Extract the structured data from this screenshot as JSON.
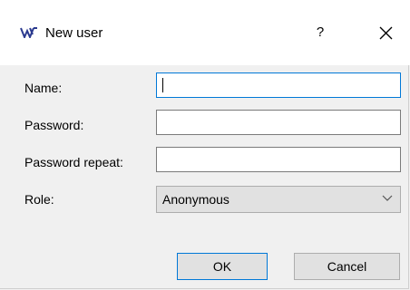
{
  "window": {
    "title": "New user",
    "help_label": "?",
    "icons": {
      "app": "app-logo-icon",
      "close": "close-icon",
      "dropdown": "chevron-down-icon"
    }
  },
  "form": {
    "name": {
      "label": "Name:",
      "value": ""
    },
    "password": {
      "label": "Password:",
      "value": ""
    },
    "password_repeat": {
      "label": "Password repeat:",
      "value": ""
    },
    "role": {
      "label": "Role:",
      "selected": "Anonymous"
    }
  },
  "buttons": {
    "ok": "OK",
    "cancel": "Cancel"
  },
  "colors": {
    "accent": "#0078d7",
    "logo": "#2b3a8f"
  }
}
